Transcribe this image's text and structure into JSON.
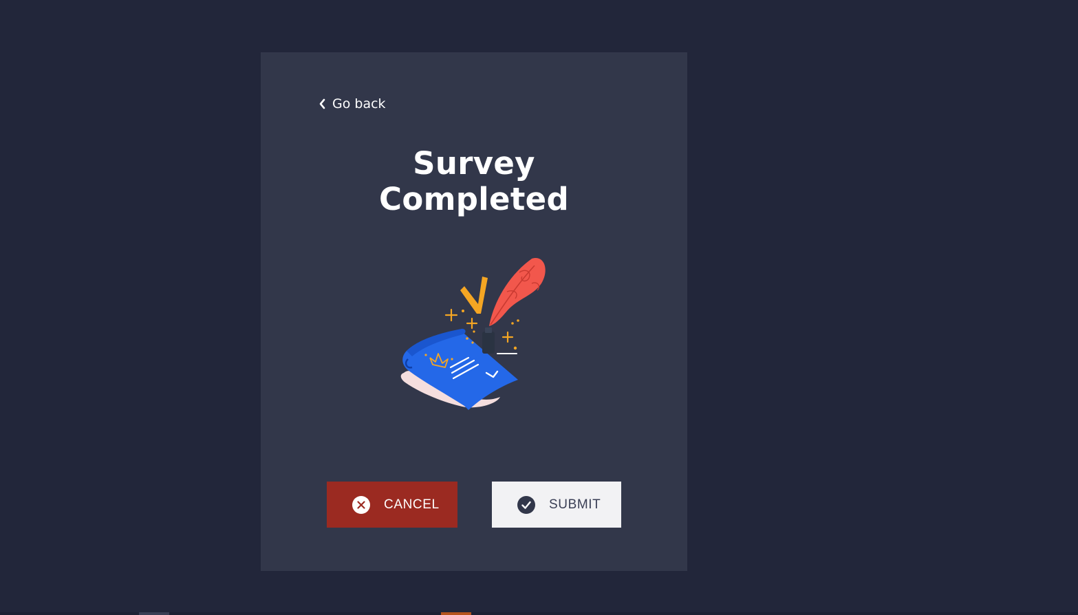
{
  "card": {
    "back_label": "Go back",
    "title_line1": "Survey",
    "title_line2": "Completed"
  },
  "illustration": {
    "icon": "quill-and-scroll-illustration",
    "colors": {
      "scroll": "#2468e8",
      "quill": "#f2574c",
      "sparkles": "#f5a623",
      "paper": "#f5dede"
    }
  },
  "actions": {
    "cancel_label": "CANCEL",
    "cancel_icon": "close-circle-icon",
    "submit_label": "SUBMIT",
    "submit_icon": "check-circle-icon"
  },
  "colors": {
    "background": "#22263a",
    "card": "#32374a",
    "cancel": "#9b2a21",
    "submit": "#f2f2f4"
  }
}
